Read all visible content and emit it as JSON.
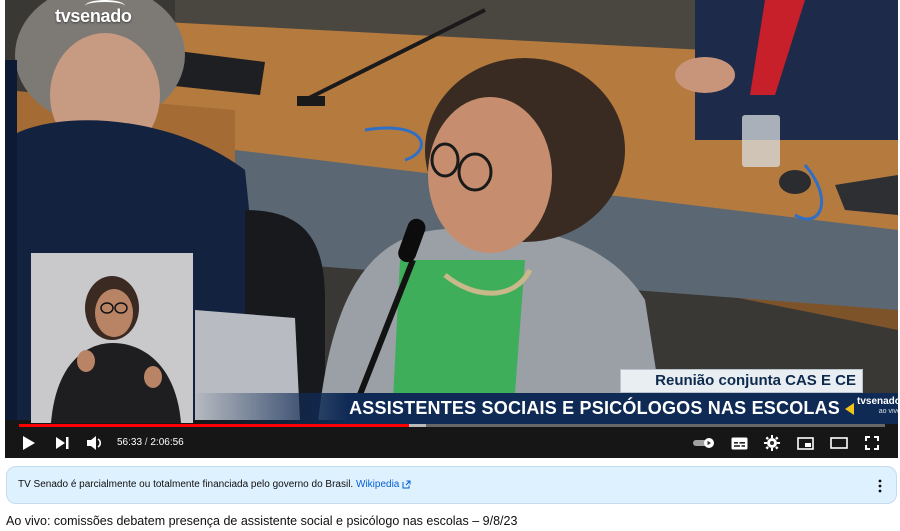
{
  "player": {
    "channel_logo": "tvsenado",
    "corner_logo": "tvsenado",
    "corner_logo_sub": "ao vivo",
    "lower_third": {
      "subtitle": "Reunião conjunta CAS E CE",
      "headline": "ASSISTENTES SOCIAIS E PSICÓLOGOS NAS ESCOLAS"
    },
    "progress": {
      "played_fraction": 0.45,
      "buffered_fraction": 0.47
    },
    "time": {
      "current": "56:33",
      "separator": " / ",
      "duration": "2:06:56"
    },
    "colors": {
      "progress_played": "#ff0000",
      "lower_third_bg": "#0f2a55",
      "accent_yellow": "#f2c418"
    },
    "icons": [
      "play-icon",
      "next-icon",
      "volume-icon",
      "autoplay-toggle-icon",
      "subtitles-icon",
      "settings-gear-icon",
      "miniplayer-icon",
      "theater-mode-icon",
      "fullscreen-icon"
    ]
  },
  "banner": {
    "text": "TV Senado é parcialmente ou totalmente financiada pelo governo do Brasil. ",
    "link_label": "Wikipedia",
    "icons": [
      "external-link-icon",
      "more-vert-icon"
    ],
    "colors": {
      "background": "#def1ff",
      "link": "#065fd4"
    }
  },
  "video": {
    "title": "Ao vivo: comissões debatem presença de assistente social e psicólogo nas escolas – 9/8/23"
  }
}
